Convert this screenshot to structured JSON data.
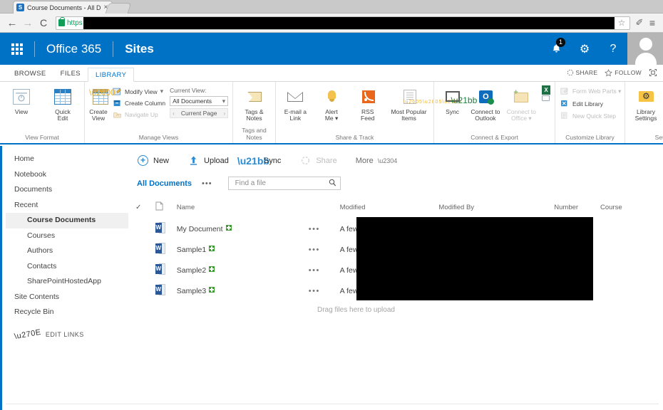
{
  "browser": {
    "tab_title": "Course Documents - All D",
    "tab_favicon": "S",
    "tab_close": "×",
    "back_icon": "←",
    "forward_icon": "→",
    "reload_icon": "C",
    "url_scheme": "https",
    "star_icon": "☆",
    "extension_icon": "✐",
    "menu_icon": "≡"
  },
  "suitebar": {
    "waffle_name": "app-launcher",
    "brand": "Office 365",
    "app": "Sites",
    "notification_badge": "1",
    "bell_icon": "🔔",
    "gear_icon": "⚙",
    "help_icon": "?"
  },
  "page_actions": {
    "share": "SHARE",
    "follow": "FOLLOW",
    "focus_icon": "⛶"
  },
  "ribbon": {
    "tabs": [
      {
        "label": "BROWSE",
        "active": false
      },
      {
        "label": "FILES",
        "active": false
      },
      {
        "label": "LIBRARY",
        "active": true
      }
    ],
    "groups": [
      {
        "label": "View Format",
        "buttons": [
          {
            "label": "View",
            "icon": "view-icon"
          },
          {
            "label": "Quick\nEdit",
            "icon": "quick-edit-icon"
          }
        ]
      },
      {
        "label": "Manage Views",
        "big": {
          "label": "Create\nView",
          "icon": "create-view-icon"
        },
        "small": [
          {
            "label": "Modify View",
            "icon": "modify-view-icon",
            "dim": false,
            "caret": "▾"
          },
          {
            "label": "Create Column",
            "icon": "create-column-icon",
            "dim": false
          },
          {
            "label": "Navigate Up",
            "icon": "navigate-up-icon",
            "dim": true
          }
        ],
        "current_view_label": "Current View:",
        "current_view_value": "All Documents",
        "current_view_caret": "▾",
        "pager_label": "Current Page",
        "pager_prev": "‹",
        "pager_next": "›"
      },
      {
        "label": "Tags and Notes",
        "buttons": [
          {
            "label": "Tags &\nNotes",
            "icon": "tags-notes-icon"
          }
        ]
      },
      {
        "label": "Share & Track",
        "buttons": [
          {
            "label": "E-mail a\nLink",
            "icon": "email-link-icon"
          },
          {
            "label": "Alert\nMe ▾",
            "icon": "alert-me-icon"
          },
          {
            "label": "RSS\nFeed",
            "icon": "rss-feed-icon"
          },
          {
            "label": "Most Popular\nItems",
            "icon": "most-popular-items-icon"
          }
        ]
      },
      {
        "label": "Connect & Export",
        "buttons": [
          {
            "label": "Sync",
            "icon": "sync-icon"
          },
          {
            "label": "Connect to\nOutlook",
            "icon": "connect-outlook-icon"
          },
          {
            "label": "Connect to\nOffice ▾",
            "icon": "connect-office-icon"
          }
        ],
        "export_icons": [
          "excel-export-icon",
          "export-rss-icon"
        ]
      },
      {
        "label": "Customize Library",
        "small": [
          {
            "label": "Form Web Parts ▾",
            "icon": "form-web-parts-icon",
            "dim": true
          },
          {
            "label": "Edit Library",
            "icon": "edit-library-icon",
            "dim": false
          },
          {
            "label": "New Quick Step",
            "icon": "new-quick-step-icon",
            "dim": true
          }
        ]
      },
      {
        "label": "Settings",
        "buttons": [
          {
            "label": "Library\nSettings",
            "icon": "library-settings-icon"
          }
        ],
        "extra_icons": [
          "shared-with-icon",
          "workflow-settings-icon"
        ],
        "extra_caret": "▾"
      }
    ]
  },
  "sidebar": {
    "items": [
      {
        "label": "Home",
        "sub": false,
        "active": false
      },
      {
        "label": "Notebook",
        "sub": false,
        "active": false
      },
      {
        "label": "Documents",
        "sub": false,
        "active": false
      },
      {
        "label": "Recent",
        "sub": false,
        "active": false
      },
      {
        "label": "Course Documents",
        "sub": true,
        "active": true
      },
      {
        "label": "Courses",
        "sub": true,
        "active": false
      },
      {
        "label": "Authors",
        "sub": true,
        "active": false
      },
      {
        "label": "Contacts",
        "sub": true,
        "active": false
      },
      {
        "label": "SharePointHostedApp",
        "sub": true,
        "active": false
      },
      {
        "label": "Site Contents",
        "sub": false,
        "active": false
      },
      {
        "label": "Recycle Bin",
        "sub": false,
        "active": false
      }
    ],
    "edit_links": "EDIT LINKS"
  },
  "commandbar": [
    {
      "label": "New",
      "icon": "new-icon",
      "dim": false
    },
    {
      "label": "Upload",
      "icon": "upload-icon",
      "dim": false
    },
    {
      "label": "Sync",
      "icon": "sync-icon",
      "dim": false
    },
    {
      "label": "Share",
      "icon": "share-icon",
      "dim": true
    },
    {
      "label": "More",
      "icon": "chevron-down-icon",
      "dim": false
    }
  ],
  "viewrow": {
    "view_name": "All Documents",
    "ellipsis": "•••",
    "search_placeholder": "Find a file",
    "search_value": "",
    "search_icon": "🔍"
  },
  "filelist": {
    "headers": {
      "check": "✓",
      "type": "ᴰ",
      "name": "Name",
      "dots": "",
      "modified": "Modified",
      "modified_by": "Modified By",
      "number": "Number",
      "course": "Course"
    },
    "rows": [
      {
        "name": "My Document",
        "badge": "new",
        "dots": "•••",
        "modified": "A few seconds ago",
        "icon": "word-document-icon"
      },
      {
        "name": "Sample1",
        "badge": "new",
        "dots": "•••",
        "modified": "A few seconds ago",
        "icon": "word-document-icon"
      },
      {
        "name": "Sample2",
        "badge": "new",
        "dots": "•••",
        "modified": "A few seconds ago",
        "icon": "word-document-icon"
      },
      {
        "name": "Sample3",
        "badge": "new",
        "dots": "•••",
        "modified": "A few seconds ago",
        "icon": "word-document-icon"
      }
    ],
    "drag_hint": "Drag files here to upload"
  },
  "colors": {
    "suite_blue": "#0072c6",
    "link_blue": "#2b8ad0",
    "word_blue": "#2b5797",
    "new_badge_green": "#3f9c35",
    "rss_orange": "#e8671c"
  }
}
